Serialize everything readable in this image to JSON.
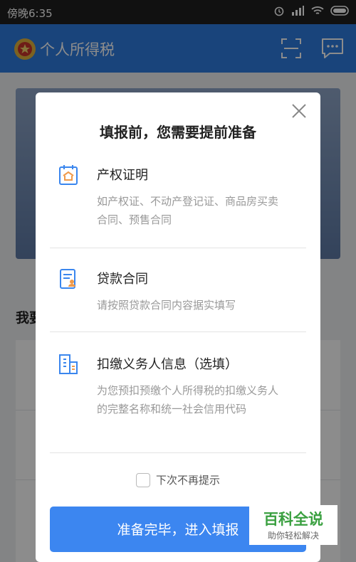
{
  "status_bar": {
    "time": "傍晚6:35"
  },
  "app_bar": {
    "title": "个人所得税",
    "icons": [
      "emblem-icon",
      "scan-icon",
      "message-icon"
    ]
  },
  "modal": {
    "title": "填报前，您需要提前准备",
    "items": [
      {
        "icon": "certificate-icon",
        "title": "产权证明",
        "desc": "如产权证、不动产登记证、商品房买卖合同、预售合同"
      },
      {
        "icon": "contract-icon",
        "title": "贷款合同",
        "desc": "请按照贷款合同内容据实填写"
      },
      {
        "icon": "building-icon",
        "title": "扣缴义务人信息（选填）",
        "desc": "为您预扣预缴个人所得税的扣缴义务人的完整名称和统一社会信用代码"
      }
    ],
    "checkbox_label": "下次不再提示",
    "primary_button": "准备完毕，进入填报"
  },
  "background": {
    "section_title": "我要"
  },
  "watermark": {
    "main": "百科全说",
    "sub": "助你轻松解决"
  },
  "colors": {
    "brand_blue": "#2f7de1",
    "button_blue": "#3c86f0",
    "icon_blue": "#3a86ee",
    "icon_orange": "#f09a4a"
  }
}
